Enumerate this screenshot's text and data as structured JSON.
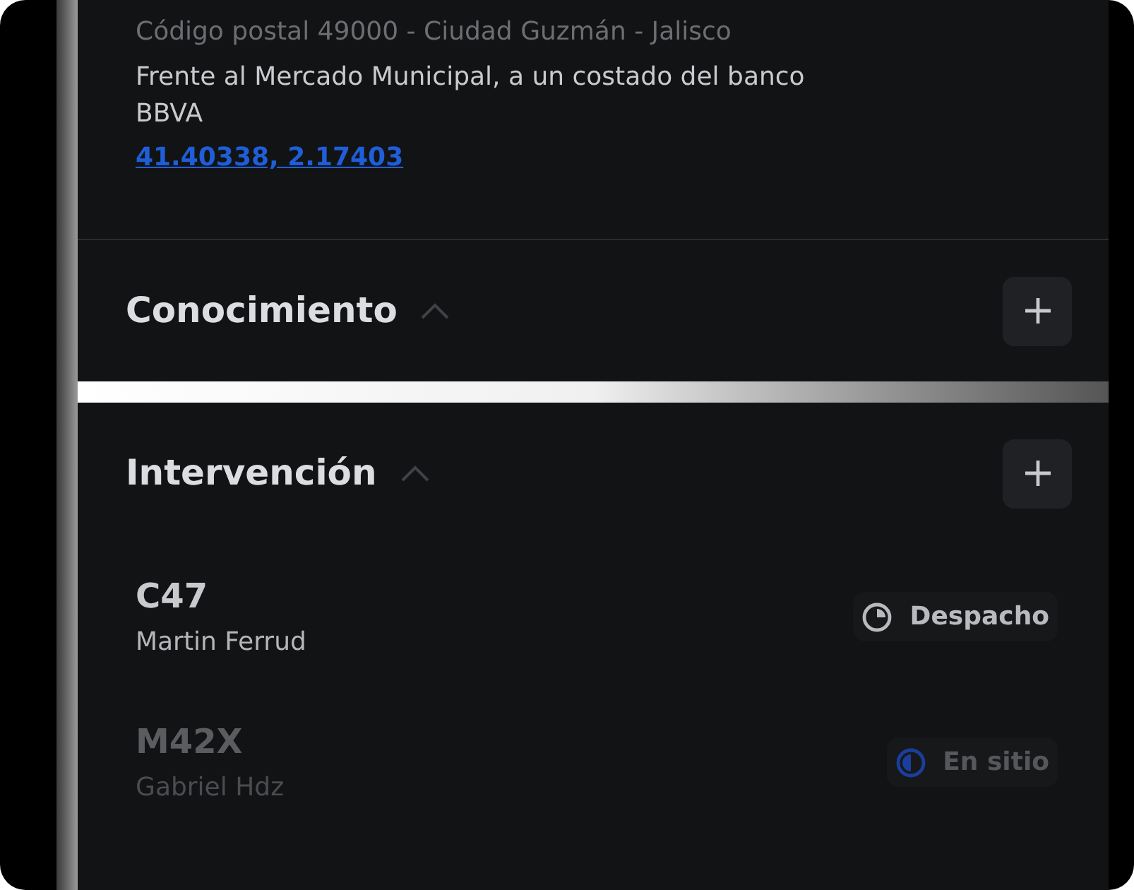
{
  "address": {
    "postal": "Código postal 49000 - Ciudad Guzmán - Jalisco",
    "reference": "Frente al Mercado Municipal, a un costado del banco BBVA",
    "coordinates": "41.40338, 2.17403"
  },
  "sections": [
    {
      "title": "Conocimiento",
      "expanded": true
    },
    {
      "title": "Intervención",
      "expanded": true
    }
  ],
  "units": [
    {
      "code": "C47",
      "person": "Martin Ferrud",
      "dimmed": false,
      "status": {
        "kind": "despacho",
        "label": "Despacho"
      }
    },
    {
      "code": "M42X",
      "person": "Gabriel Hdz",
      "dimmed": true,
      "status": {
        "kind": "en_sitio",
        "label": "En sitio"
      }
    }
  ]
}
